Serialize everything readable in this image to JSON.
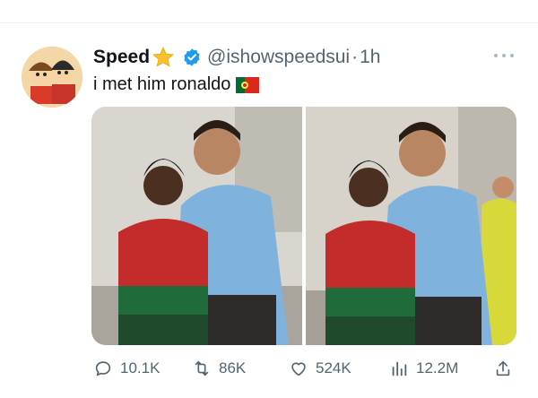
{
  "tweet": {
    "display_name": "Speed",
    "handle": "@ishowspeedsui",
    "separator": "·",
    "timestamp": "1h",
    "text": "i met him ronaldo",
    "name_emoji": "star-icon",
    "text_emoji": "portugal-flag-icon",
    "verified": true,
    "media_count": 2
  },
  "actions": {
    "replies": "10.1K",
    "retweets": "86K",
    "likes": "524K",
    "views": "12.2M"
  },
  "colors": {
    "text_primary": "#0f1419",
    "text_secondary": "#536471",
    "verified_blue": "#1d9bf0",
    "divider": "#eff3f4"
  },
  "icons": {
    "reply": "speech-bubble-icon",
    "retweet": "retweet-arrows-icon",
    "like": "heart-icon",
    "views": "bar-chart-icon",
    "share": "share-upload-icon",
    "more": "ellipsis-icon"
  }
}
